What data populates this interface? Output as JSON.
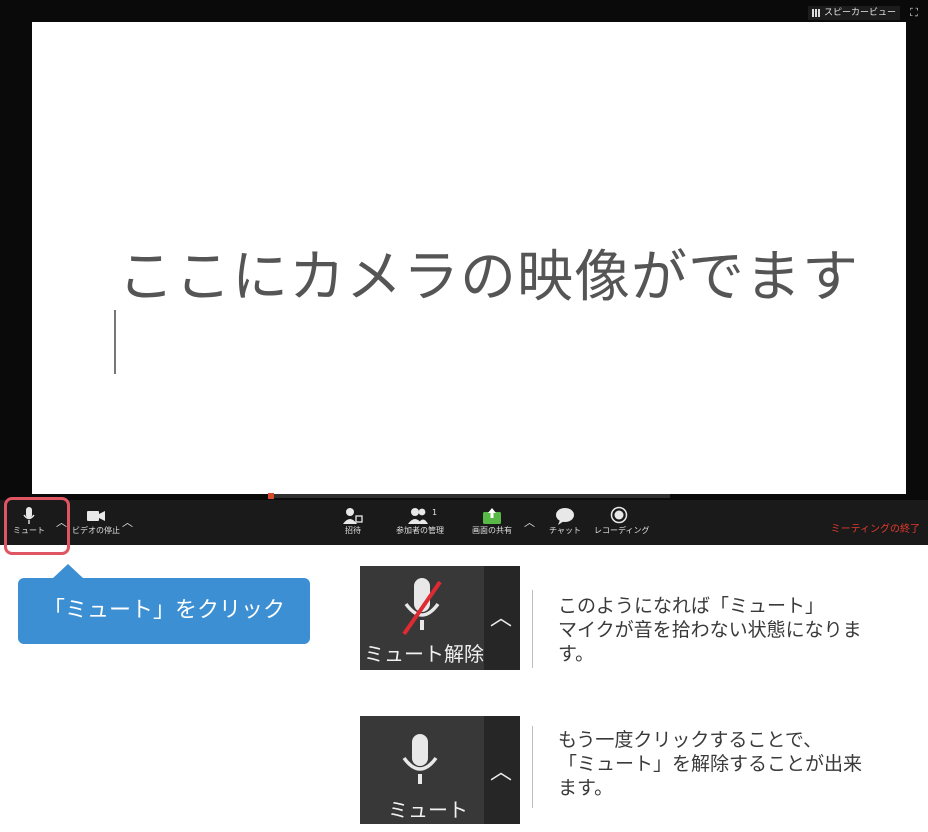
{
  "window": {
    "video_text": "ここにカメラの映像がでます",
    "speaker_view_label": "スピーカービュー",
    "fullscreen_icon": "fullscreen-icon"
  },
  "toolbar": {
    "mute_label": "ミュート",
    "video_label": "ビデオの停止",
    "invite_label": "招待",
    "participants_label": "参加者の管理",
    "participants_count": "1",
    "share_label": "画面の共有",
    "chat_label": "チャット",
    "record_label": "レコーディング",
    "end_label": "ミーティングの終了",
    "colors": {
      "share": "#58b947",
      "end": "#e23b2e"
    }
  },
  "callout": {
    "text": "「ミュート」をクリック",
    "color": "#3d8fd3"
  },
  "states": {
    "unmute": {
      "button_label": "ミュート解除",
      "description": [
        "このようになれば「ミュート」",
        "マイクが音を拾わない状態になりま",
        "す。"
      ]
    },
    "mute": {
      "button_label": "ミュート",
      "description": [
        "もう一度クリックすることで、",
        "「ミュート」を解除することが出来",
        "ます。"
      ]
    }
  },
  "highlight_color": "#e05562"
}
